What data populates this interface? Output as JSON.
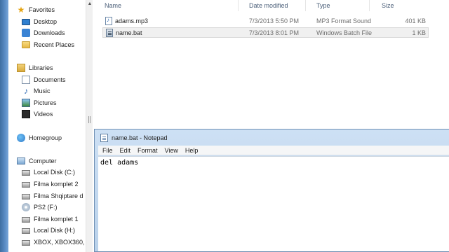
{
  "navigation": {
    "favorites": {
      "label": "Favorites",
      "items": [
        {
          "label": "Desktop",
          "icon": "desktop-icon"
        },
        {
          "label": "Downloads",
          "icon": "downloads-icon"
        },
        {
          "label": "Recent Places",
          "icon": "recent-places-icon"
        }
      ]
    },
    "libraries": {
      "label": "Libraries",
      "items": [
        {
          "label": "Documents",
          "icon": "documents-icon"
        },
        {
          "label": "Music",
          "icon": "music-icon"
        },
        {
          "label": "Pictures",
          "icon": "pictures-icon"
        },
        {
          "label": "Videos",
          "icon": "videos-icon"
        }
      ]
    },
    "homegroup": {
      "label": "Homegroup"
    },
    "computer": {
      "label": "Computer",
      "items": [
        {
          "label": "Local Disk (C:)",
          "icon": "local-disk-icon"
        },
        {
          "label": "Filma komplet 2",
          "icon": "drive-icon"
        },
        {
          "label": "Filma Shqiptare d",
          "icon": "drive-icon"
        },
        {
          "label": "PS2 (F:)",
          "icon": "dvd-drive-icon"
        },
        {
          "label": "Filma komplet 1",
          "icon": "drive-icon"
        },
        {
          "label": "Local Disk (H:)",
          "icon": "drive-icon"
        },
        {
          "label": "XBOX, XBOX360,",
          "icon": "drive-icon"
        }
      ]
    }
  },
  "file_list": {
    "columns": {
      "name": "Name",
      "date_modified": "Date modified",
      "type": "Type",
      "size": "Size"
    },
    "rows": [
      {
        "name": "adams.mp3",
        "date_modified": "7/3/2013 5:50 PM",
        "type": "MP3 Format Sound",
        "size": "401 KB",
        "icon": "mp3-file-icon",
        "selected": false
      },
      {
        "name": "name.bat",
        "date_modified": "7/3/2013 8:01 PM",
        "type": "Windows Batch File",
        "size": "1 KB",
        "icon": "batch-file-icon",
        "selected": true
      }
    ]
  },
  "notepad": {
    "title": "name.bat - Notepad",
    "menu": [
      "File",
      "Edit",
      "Format",
      "View",
      "Help"
    ],
    "content": "del adams"
  }
}
